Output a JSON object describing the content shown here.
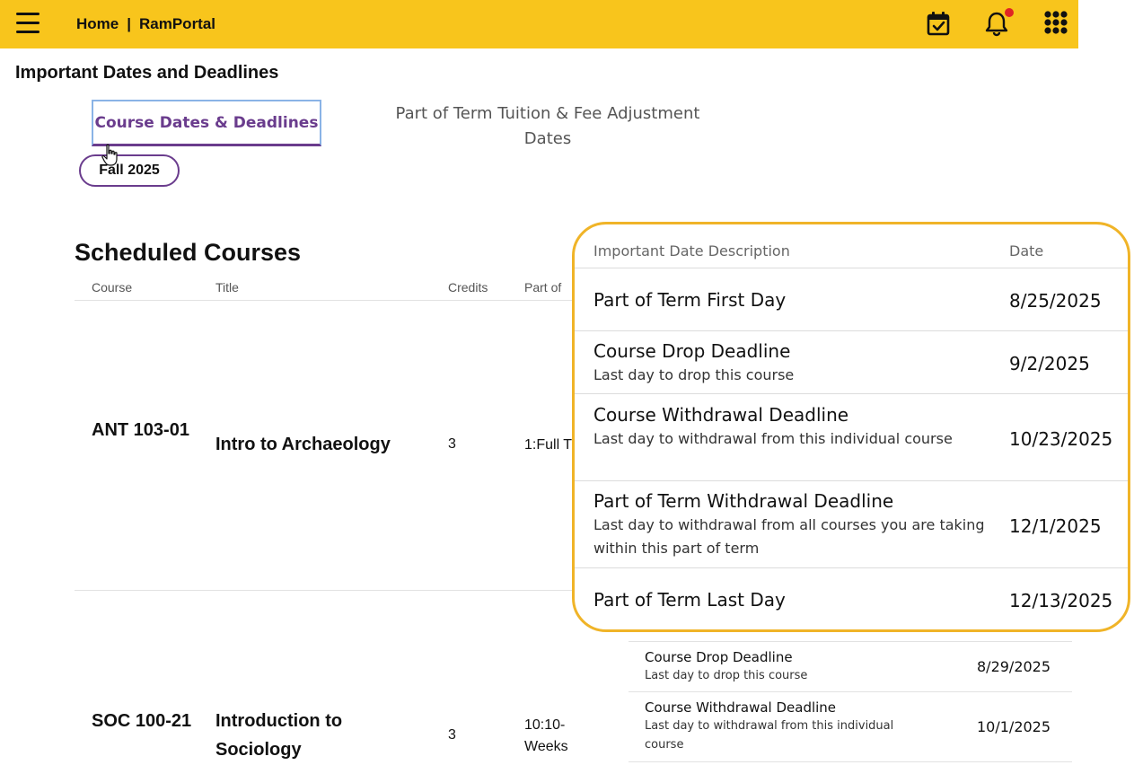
{
  "header": {
    "home_label": "Home",
    "separator": "|",
    "portal_label": "RamPortal",
    "notification_color": "#e02424",
    "bar_color": "#f8c51c"
  },
  "page": {
    "title": "Important Dates and Deadlines"
  },
  "tabs": [
    {
      "label": "Course Dates & Deadlines",
      "active": true
    },
    {
      "label": "Part of Term Tuition & Fee Adjustment Dates",
      "active": false
    }
  ],
  "term": {
    "label": "Fall 2025"
  },
  "scheduled": {
    "title": "Scheduled Courses",
    "columns": [
      "Course",
      "Title",
      "Credits",
      "Part of"
    ],
    "courses": [
      {
        "code": "ANT 103-01",
        "title": "Intro to Archaeology",
        "credits": "3",
        "part": "1:Full T"
      },
      {
        "code": "SOC 100-21",
        "title": "Introduction to Sociology",
        "credits": "3",
        "part": "10:10-Weeks"
      }
    ],
    "soc_dates": [
      {
        "title": "Course Drop Deadline",
        "note": "Last day to drop this course",
        "date": "8/29/2025"
      },
      {
        "title": "Course Withdrawal Deadline",
        "note": "Last day to withdrawal from this individual course",
        "date": "10/1/2025"
      }
    ]
  },
  "popup": {
    "col_description": "Important Date Description",
    "col_date": "Date",
    "border_color": "#f0b428",
    "rows": [
      {
        "title": "Part of Term First Day",
        "note": "",
        "date": "8/25/2025"
      },
      {
        "title": "Course Drop Deadline",
        "note": "Last day to drop this course",
        "date": "9/2/2025"
      },
      {
        "title": "Course Withdrawal Deadline",
        "note": "Last day to withdrawal from this individual course",
        "date": "10/23/2025"
      },
      {
        "title": "Part of Term Withdrawal Deadline",
        "note": "Last day to withdrawal from all courses you are taking within this part of term",
        "date": "12/1/2025"
      },
      {
        "title": "Part of Term Last Day",
        "note": "",
        "date": "12/13/2025"
      }
    ]
  }
}
